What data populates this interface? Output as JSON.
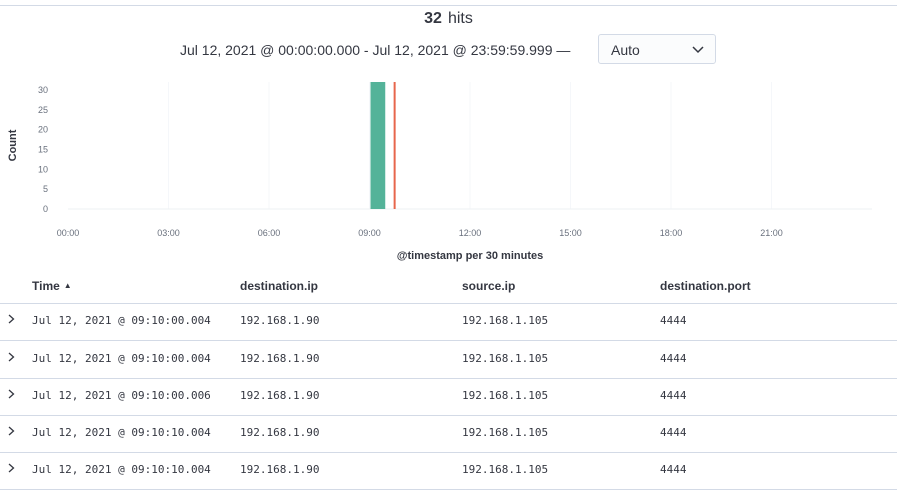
{
  "summary": {
    "hits_count": "32",
    "hits_label": "hits"
  },
  "time_range": {
    "text": "Jul 12, 2021 @ 00:00:00.000 - Jul 12, 2021 @ 23:59:59.999 —",
    "interval": "Auto"
  },
  "chart_data": {
    "type": "bar",
    "ylabel": "Count",
    "xlabel": "@timestamp per 30 minutes",
    "y_ticks": [
      "0",
      "5",
      "10",
      "15",
      "20",
      "25",
      "30"
    ],
    "x_ticks": [
      "00:00",
      "03:00",
      "06:00",
      "09:00",
      "12:00",
      "15:00",
      "18:00",
      "21:00"
    ],
    "ylim": [
      0,
      32
    ],
    "xlim_hours": [
      0,
      24
    ],
    "bars": [
      {
        "start_hour": 9.0,
        "end_hour": 9.5,
        "value": 32
      }
    ],
    "marker_hour": 9.75,
    "colors": {
      "bar": "#54b399",
      "marker": "#e7664c"
    }
  },
  "table": {
    "columns": [
      "Time",
      "destination.ip",
      "source.ip",
      "destination.port"
    ],
    "rows": [
      [
        "Jul 12, 2021 @ 09:10:00.004",
        "192.168.1.90",
        "192.168.1.105",
        "4444"
      ],
      [
        "Jul 12, 2021 @ 09:10:00.004",
        "192.168.1.90",
        "192.168.1.105",
        "4444"
      ],
      [
        "Jul 12, 2021 @ 09:10:00.006",
        "192.168.1.90",
        "192.168.1.105",
        "4444"
      ],
      [
        "Jul 12, 2021 @ 09:10:10.004",
        "192.168.1.90",
        "192.168.1.105",
        "4444"
      ],
      [
        "Jul 12, 2021 @ 09:10:10.004",
        "192.168.1.90",
        "192.168.1.105",
        "4444"
      ]
    ]
  }
}
